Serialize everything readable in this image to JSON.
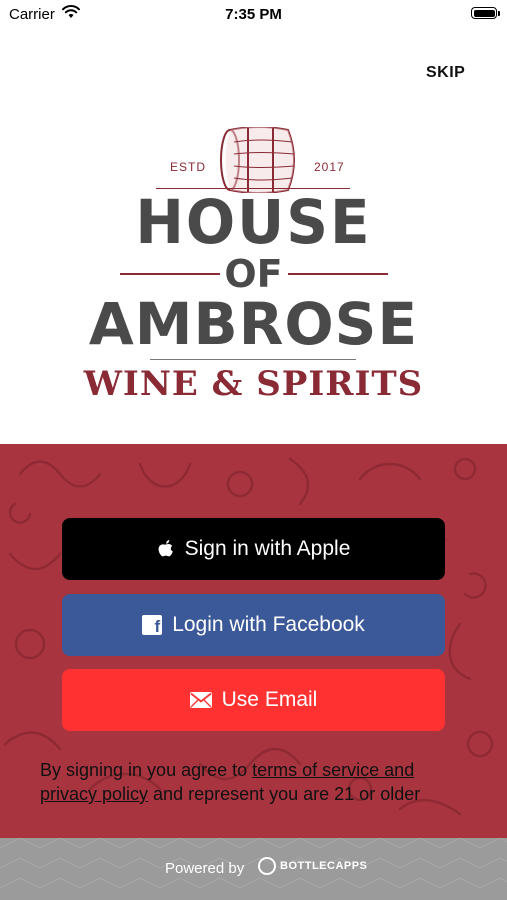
{
  "status_bar": {
    "carrier": "Carrier",
    "time": "7:35 PM"
  },
  "header": {
    "skip_label": "SKIP"
  },
  "logo": {
    "estd": "ESTD",
    "year": "2017",
    "line1": "HOUSE",
    "line2": "OF",
    "line3": "AMBROSE",
    "line4": "WINE & SPIRITS"
  },
  "actions": {
    "apple_label": "Sign in with Apple",
    "facebook_label": "Login with Facebook",
    "email_label": "Use Email"
  },
  "legal": {
    "prefix": "By signing in you agree to ",
    "link": "terms of service and privacy policy",
    "suffix": " and represent you are 21 or older"
  },
  "footer": {
    "powered_by": "Powered by",
    "brand": "BOTTLECAPPS"
  },
  "colors": {
    "panel": "#a8343f",
    "apple": "#000000",
    "facebook": "#3b5998",
    "email": "#ff3131",
    "brand_red": "#8a2a35",
    "footer": "#9b9b9b"
  },
  "icons": [
    "wifi-icon",
    "battery-icon",
    "barrel-icon",
    "apple-icon",
    "facebook-icon",
    "mail-icon",
    "bottlecapps-logo-icon"
  ]
}
